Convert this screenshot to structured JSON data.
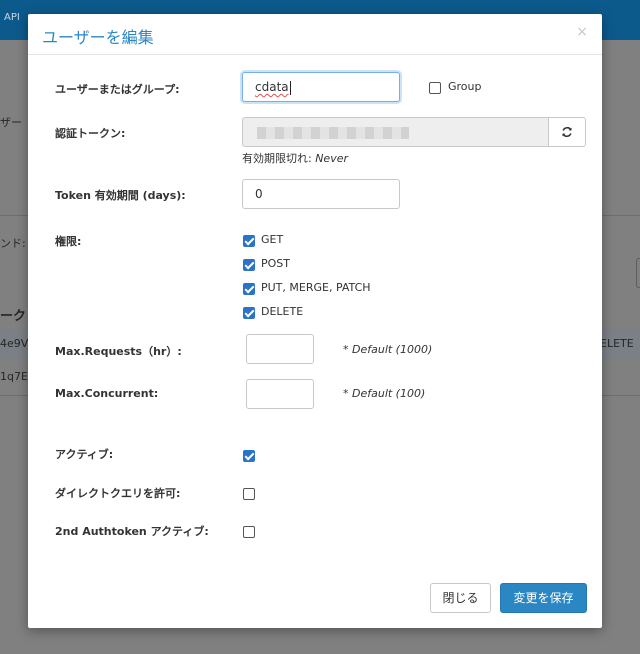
{
  "background": {
    "api_label": "API",
    "frag_user": "ザー",
    "frag_command": "ンド:",
    "frag_token": "ーク",
    "row1_id": "4e9V",
    "row1_right": "ELETE",
    "row2_id": "1q7E"
  },
  "modal": {
    "title": "ユーザーを編集",
    "close_icon": "×"
  },
  "form": {
    "user_label": "ユーザーまたはグループ:",
    "user_value": "cdata",
    "group_label": "Group",
    "group_checked": false,
    "token_label": "認証トークン:",
    "expiry_prefix": "有効期限切れ: ",
    "expiry_value": "Never",
    "token_period_label": "Token 有効期間 (days):",
    "token_period_value": "0",
    "permissions_label": "権限:",
    "permissions": [
      {
        "label": "GET",
        "checked": true
      },
      {
        "label": "POST",
        "checked": true
      },
      {
        "label": "PUT, MERGE, PATCH",
        "checked": true
      },
      {
        "label": "DELETE",
        "checked": true
      }
    ],
    "max_requests_label": "Max.Requests（hr）:",
    "max_requests_value": "",
    "max_requests_hint": "* Default (1000)",
    "max_concurrent_label": "Max.Concurrent:",
    "max_concurrent_value": "",
    "max_concurrent_hint": "* Default (100)",
    "active_label": "アクティブ:",
    "active_checked": true,
    "allow_direct_query_label": "ダイレクトクエリを許可:",
    "allow_direct_query_checked": false,
    "second_token_label": "2nd Authtoken アクティブ:",
    "second_token_checked": false
  },
  "buttons": {
    "close_label": "閉じる",
    "save_label": "変更を保存"
  },
  "icons": {
    "refresh": "refresh-icon",
    "close": "close-icon"
  },
  "colors": {
    "accent": "#2b87c4",
    "checkbox": "#2a73c9"
  }
}
